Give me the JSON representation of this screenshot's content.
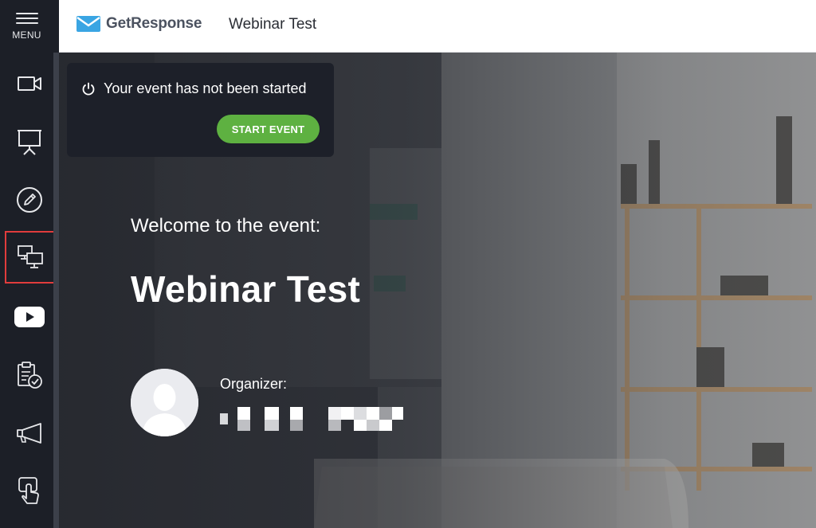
{
  "sidebar": {
    "menu_label": "MENU",
    "items": [
      {
        "name": "camera",
        "icon": "video-camera-icon"
      },
      {
        "name": "presentation",
        "icon": "presentation-board-icon"
      },
      {
        "name": "whiteboard",
        "icon": "pencil-icon"
      },
      {
        "name": "screen-sharing",
        "icon": "screen-share-icon",
        "active": true
      },
      {
        "name": "video",
        "icon": "youtube-icon"
      },
      {
        "name": "tests",
        "icon": "clipboard-check-icon"
      },
      {
        "name": "call-to-action",
        "icon": "megaphone-icon"
      },
      {
        "name": "interactions",
        "icon": "hand-touch-icon"
      }
    ],
    "active_border_color": "#e03c3c"
  },
  "header": {
    "brand": "GetResponse",
    "title": "Webinar Test"
  },
  "notice": {
    "text": "Your event has not been started",
    "button_label": "START EVENT",
    "button_color": "#5eb141"
  },
  "welcome": {
    "intro": "Welcome to the event:",
    "event_title": "Webinar Test",
    "organizer_label": "Organizer:"
  }
}
